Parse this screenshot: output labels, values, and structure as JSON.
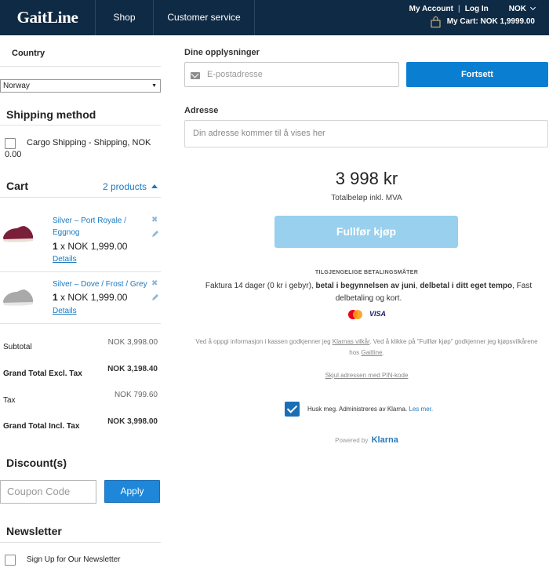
{
  "header": {
    "logo": "GaitLine",
    "nav": [
      "Shop",
      "Customer service"
    ],
    "my_account": "My Account",
    "log_in": "Log In",
    "currency": "NOK",
    "cart_summary": "My Cart: NOK 1,9999.00"
  },
  "left": {
    "country": {
      "heading": "Country",
      "selected": "Norway"
    },
    "shipping": {
      "title": "Shipping method",
      "option": "Cargo Shipping - Shipping, NOK 0.00"
    },
    "cart": {
      "title": "Cart",
      "count": "2 products",
      "items": [
        {
          "name": "Silver – Port Royale / Eggnog",
          "qty": "1",
          "price": "x NOK 1,999.00",
          "details": "Details",
          "color": "#7a1f3a"
        },
        {
          "name": "Silver – Dove / Frost / Grey",
          "qty": "1",
          "price": "x NOK 1,999.00",
          "details": "Details",
          "color": "#a9a9a9"
        }
      ]
    },
    "totals": [
      {
        "label": "Subtotal",
        "value": "NOK 3,998.00",
        "bold": false
      },
      {
        "label": "Grand Total Excl. Tax",
        "value": "NOK 3,198.40",
        "bold": true
      },
      {
        "label": "Tax",
        "value": "NOK 799.60",
        "bold": false
      },
      {
        "label": "Grand Total Incl. Tax",
        "value": "NOK 3,998.00",
        "bold": true
      }
    ],
    "discount": {
      "title": "Discount(s)",
      "placeholder": "Coupon Code",
      "button": "Apply"
    },
    "newsletter": {
      "title": "Newsletter",
      "option": "Sign Up for Our Newsletter"
    }
  },
  "klarna": {
    "details_label": "Dine opplysninger",
    "email_placeholder": "E-postadresse",
    "continue_button": "Fortsett",
    "address_label": "Adresse",
    "address_placeholder": "Din adresse kommer til å vises her",
    "total_amount": "3 998 kr",
    "total_sub": "Totalbeløp inkl. MVA",
    "complete_button": "Fullfør kjøp",
    "payment_heading": "TILGJENGELIGE BETALINGSMÅTER",
    "payment_text": {
      "p1": "Faktura 14 dager (0 kr i gebyr), ",
      "b1": "betal i begynnelsen av juni",
      "p2": ", ",
      "b2": "delbetal i ditt eget tempo",
      "p3": ", Fast delbetaling og kort."
    },
    "visa": "VISA",
    "terms": {
      "t1": "Ved å oppgi informasjon i kassen godkjenner jeg ",
      "l1": "Klarnas vilkår",
      "t2": ". Ved å klikke på \"Fullfør kjøp\" godkjenner jeg kjøpsvilkårene hos ",
      "l2": "Gaitline",
      "t3": "."
    },
    "hide_address": "Skjul adressen med PIN-kode",
    "remember": "Husk meg. Administreres av Klarna.",
    "learn_more": "Les mer.",
    "powered_by": "Powered by",
    "klarna_brand": "Klarna",
    "primary_color": "#0a7fd1",
    "disabled_color": "#98d0ee"
  }
}
